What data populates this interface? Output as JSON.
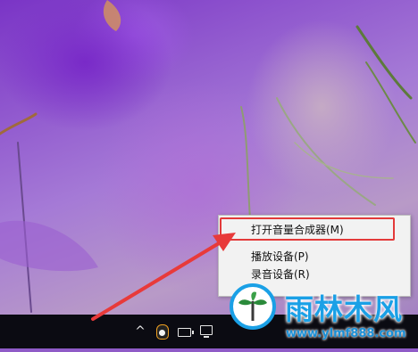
{
  "context_menu": {
    "items": [
      {
        "label": "打开音量合成器(M)"
      },
      {
        "label": "播放设备(P)"
      },
      {
        "label": "录音设备(R)"
      }
    ],
    "highlight_color": "#e33a3a"
  },
  "taskbar": {
    "tray_icons": [
      "chevron-up-icon",
      "qq-icon",
      "battery-icon",
      "network-icon"
    ],
    "chevron_glyph": "^"
  },
  "watermark": {
    "title": "雨林木风",
    "url": "www.ylmf888.com",
    "color": "#1aa0e6"
  }
}
